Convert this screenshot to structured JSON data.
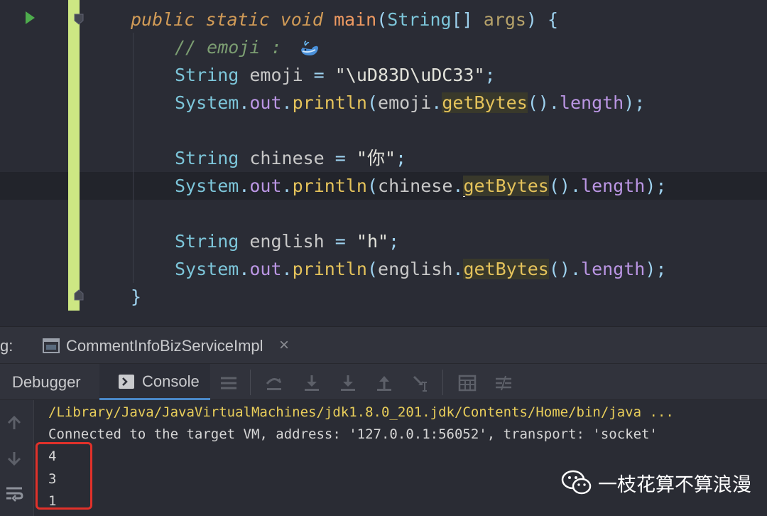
{
  "editor": {
    "lines": [
      {
        "parts": [
          [
            "kw",
            "public static void "
          ],
          [
            "fn",
            "main"
          ],
          [
            "pun",
            "("
          ],
          [
            "cls",
            "String"
          ],
          [
            "pun",
            "[] "
          ],
          [
            "par",
            "args"
          ],
          [
            "pun",
            ") {"
          ]
        ]
      },
      {
        "parts": [
          [
            "cmt",
            "// emoji : "
          ]
        ],
        "emoji": "whale-emoji-icon"
      },
      {
        "parts": [
          [
            "cls",
            "String "
          ],
          [
            "",
            "emoji "
          ],
          [
            "pun",
            "= "
          ],
          [
            "str",
            "\"\\uD83D\\uDC33\""
          ],
          [
            "pun",
            ";"
          ]
        ]
      },
      {
        "parts": [
          [
            "cls",
            "System"
          ],
          [
            "pun",
            "."
          ],
          [
            "field",
            "out"
          ],
          [
            "pun",
            "."
          ],
          [
            "method",
            "println"
          ],
          [
            "pun",
            "("
          ],
          [
            "",
            "emoji"
          ],
          [
            "pun",
            "."
          ],
          [
            "method hl",
            "getBytes"
          ],
          [
            "pun",
            "()."
          ],
          [
            "field",
            "length"
          ],
          [
            "pun",
            ");"
          ]
        ]
      },
      {
        "parts": []
      },
      {
        "parts": [
          [
            "cls",
            "String "
          ],
          [
            "",
            "chinese "
          ],
          [
            "pun",
            "= "
          ],
          [
            "str",
            "\"你\""
          ],
          [
            "pun",
            ";"
          ]
        ]
      },
      {
        "parts": [
          [
            "cls",
            "System"
          ],
          [
            "pun",
            "."
          ],
          [
            "field",
            "out"
          ],
          [
            "pun",
            "."
          ],
          [
            "method",
            "println"
          ],
          [
            "pun",
            "("
          ],
          [
            "",
            "chinese"
          ],
          [
            "pun",
            "."
          ],
          [
            "caret",
            ""
          ],
          [
            "method hl",
            "getBytes"
          ],
          [
            "pun",
            "()."
          ],
          [
            "field",
            "length"
          ],
          [
            "pun",
            ");"
          ]
        ]
      },
      {
        "parts": []
      },
      {
        "parts": [
          [
            "cls",
            "String "
          ],
          [
            "",
            "english "
          ],
          [
            "pun",
            "= "
          ],
          [
            "str",
            "\"h\""
          ],
          [
            "pun",
            ";"
          ]
        ]
      },
      {
        "parts": [
          [
            "cls",
            "System"
          ],
          [
            "pun",
            "."
          ],
          [
            "field",
            "out"
          ],
          [
            "pun",
            "."
          ],
          [
            "method",
            "println"
          ],
          [
            "pun",
            "("
          ],
          [
            "",
            "english"
          ],
          [
            "pun",
            "."
          ],
          [
            "method hl",
            "getBytes"
          ],
          [
            "pun",
            "()."
          ],
          [
            "field",
            "length"
          ],
          [
            "pun",
            ");"
          ]
        ]
      },
      {
        "parts": [
          [
            "pun",
            "}"
          ]
        ]
      }
    ]
  },
  "run_panel": {
    "label": "g:",
    "tab_title": "CommentInfoBizServiceImpl",
    "close_glyph": "×"
  },
  "toolbar": {
    "debugger_tab": "Debugger",
    "console_tab": "Console"
  },
  "console": {
    "lines": [
      {
        "text": "/Library/Java/JavaVirtualMachines/jdk1.8.0_201.jdk/Contents/Home/bin/java ...",
        "color": "#e9ce5a"
      },
      {
        "text": "Connected to the target VM, address: '127.0.0.1:56052', transport: 'socket'",
        "color": "#d6d6d6"
      },
      {
        "text": "4",
        "color": "#d6d6d6"
      },
      {
        "text": "3",
        "color": "#d6d6d6"
      },
      {
        "text": "1",
        "color": "#d6d6d6"
      }
    ]
  },
  "watermark": {
    "icon": "wechat-icon",
    "text": "一枝花算不算浪漫"
  },
  "colors": {
    "editor_bg": "#2a2c35",
    "gutter_changed": "#cde783",
    "highlight_box": "#e1312a"
  }
}
